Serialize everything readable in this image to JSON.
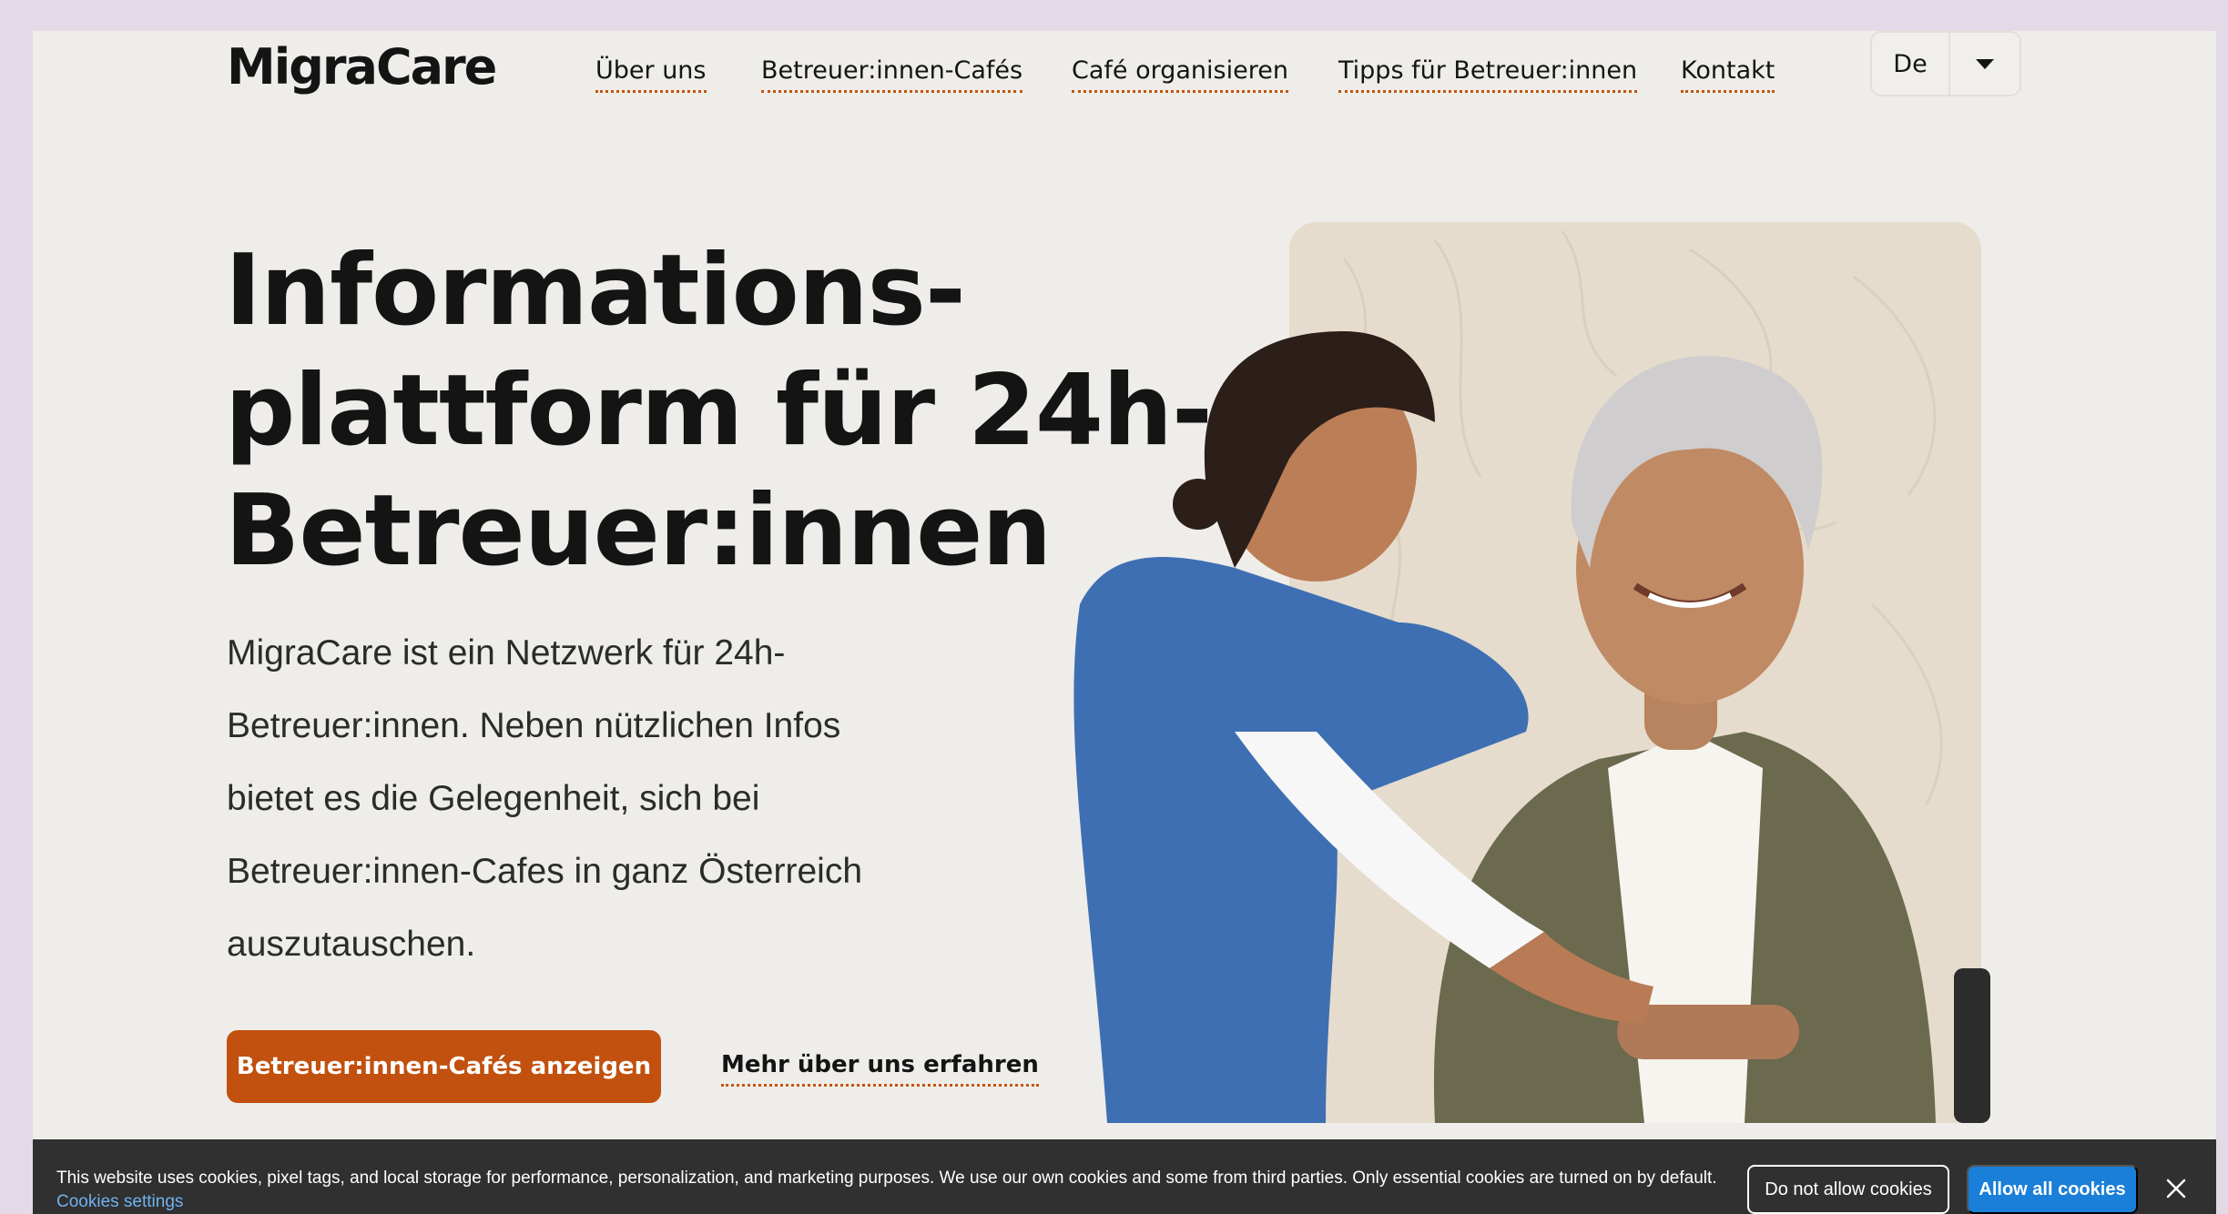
{
  "header": {
    "logo": "MigraCare",
    "nav": [
      {
        "label": "Über uns"
      },
      {
        "label": "Betreuer:innen-Cafés"
      },
      {
        "label": "Café organisieren"
      },
      {
        "label": "Tipps für Betreuer:innen"
      },
      {
        "label": "Kontakt"
      }
    ],
    "language": {
      "value": "De",
      "icon": "chevron-down-icon"
    }
  },
  "hero": {
    "headline_lines": [
      "Informations-",
      "plattform für 24h-",
      "Betreuer:innen"
    ],
    "lede": "MigraCare ist ein Netzwerk für 24h-Betreuer:innen. Neben nützlichen Infos bietet es die Gelegenheit, sich bei Betreuer:innen-Cafes in ganz Österreich auszutauschen.",
    "primary_button": "Betreuer:innen-Cafés anzeigen",
    "secondary_link": "Mehr über uns erfahren"
  },
  "cookie_banner": {
    "text": "This website uses cookies, pixel tags, and local storage for performance, personalization, and marketing purposes. We use our own cookies and some from third parties. Only essential cookies are turned on by default.",
    "settings_link": "Cookies settings",
    "deny_button": "Do not allow cookies",
    "allow_button": "Allow all cookies",
    "close_icon": "close-icon"
  },
  "colors": {
    "page_bg": "#efede9",
    "accent": "#c2500e",
    "banner_bg": "#303030",
    "allow_blue": "#1a7fd8"
  }
}
